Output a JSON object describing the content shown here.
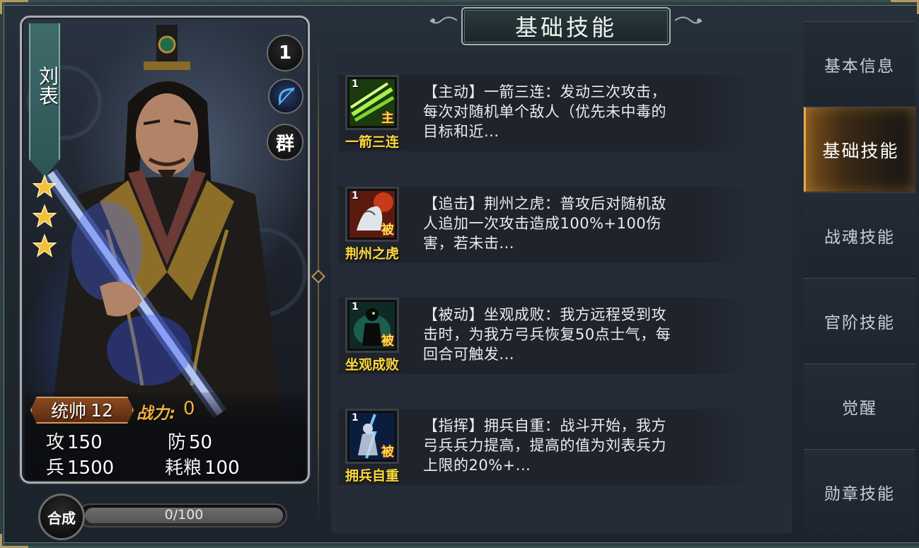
{
  "hero": {
    "name": "刘表",
    "level": "1",
    "faction": "群",
    "class_icon": "bow-icon",
    "stars": 3,
    "rank_label": "统帅",
    "rank_value": "12",
    "power_label": "战力:",
    "power_value": "0",
    "stats": [
      {
        "key": "攻",
        "value": "150"
      },
      {
        "key": "防",
        "value": "50"
      },
      {
        "key": "兵",
        "value": "1500"
      },
      {
        "key": "耗粮",
        "value": "100"
      }
    ]
  },
  "synth": {
    "button_label": "合成",
    "progress_text": "0/100",
    "progress": 0
  },
  "title": "基础技能",
  "skills": [
    {
      "level": "1",
      "tag": "主",
      "name": "一箭三连",
      "desc": "【主动】一箭三连：发动三次攻击，每次对随机单个敌人（优先未中毒的目标和近...",
      "icon_name": "arrow-volley-icon"
    },
    {
      "level": "1",
      "tag": "被",
      "name": "荆州之虎",
      "desc": "【追击】荆州之虎：普攻后对随机敌人追加一次攻击造成100%+100伤害，若未击...",
      "icon_name": "white-tiger-icon"
    },
    {
      "level": "1",
      "tag": "被",
      "name": "坐观成败",
      "desc": "【被动】坐观成败：我方远程受到攻击时，为我方弓兵恢复50点士气，每回合可触发...",
      "icon_name": "shadow-warrior-icon"
    },
    {
      "level": "1",
      "tag": "被",
      "name": "拥兵自重",
      "desc": "【指挥】拥兵自重：战斗开始，我方弓兵兵力提高，提高的值为刘表兵力上限的20%+...",
      "icon_name": "lightning-soldier-icon"
    }
  ],
  "tabs": [
    {
      "label": "基本信息"
    },
    {
      "label": "基础技能"
    },
    {
      "label": "战魂技能"
    },
    {
      "label": "官阶技能"
    },
    {
      "label": "觉醒"
    },
    {
      "label": "勋章技能"
    }
  ],
  "active_tab": 1,
  "colors": {
    "skill_name": "#ffd83d",
    "power": "#f0b040",
    "active_tab_glow": "#e6a94a"
  }
}
